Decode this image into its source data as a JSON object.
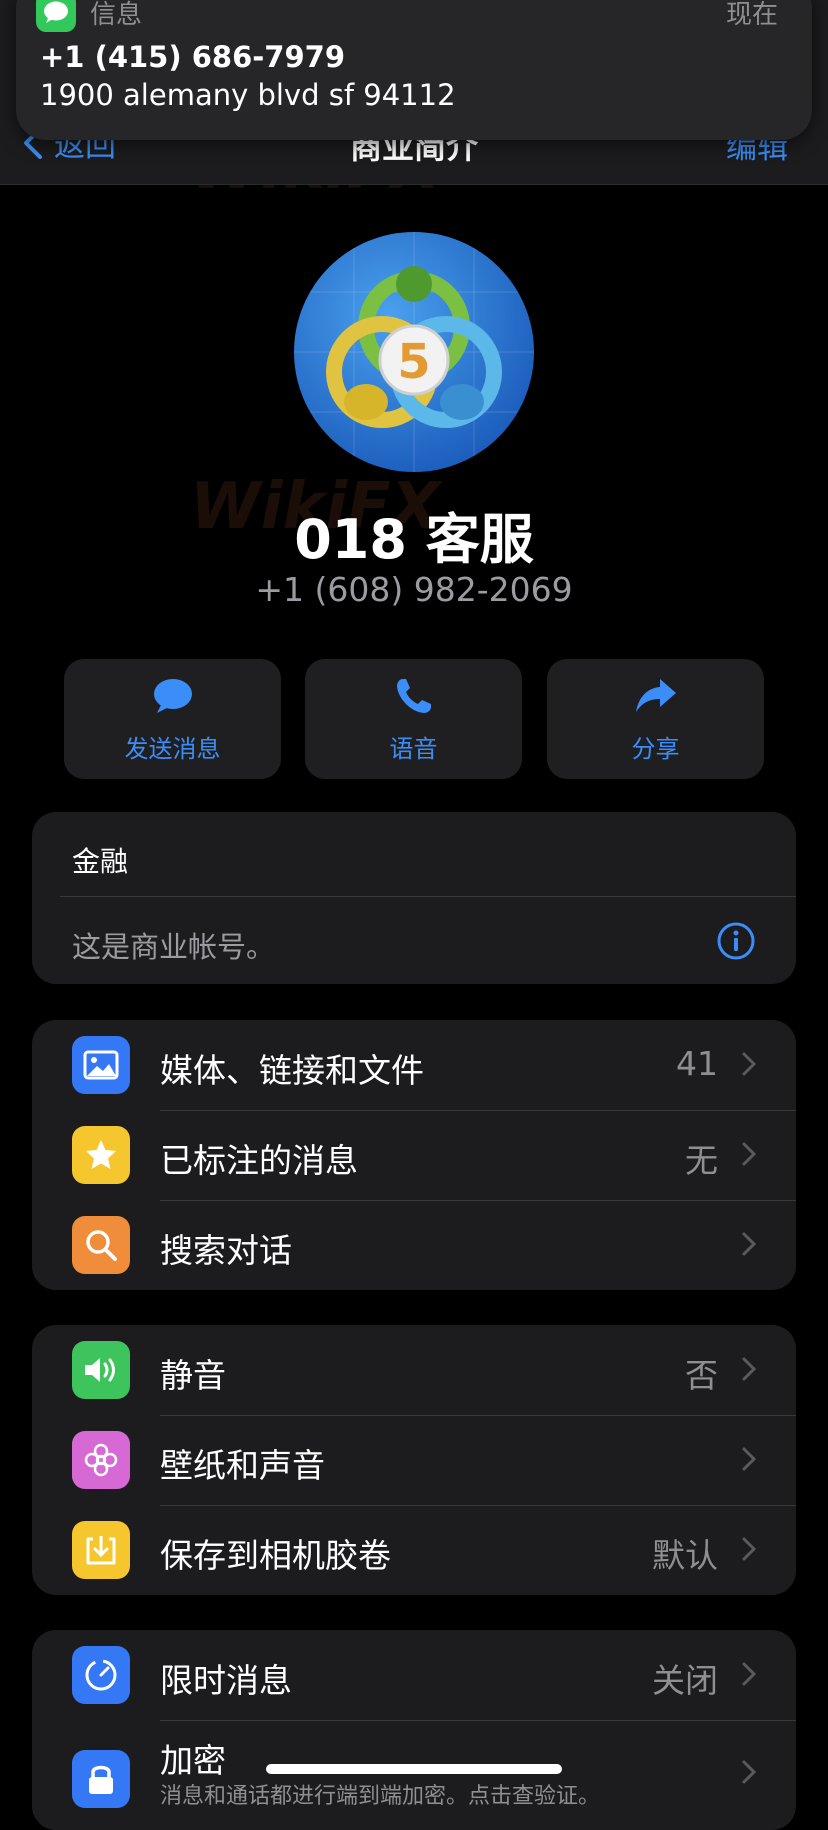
{
  "notification": {
    "app_name": "信息",
    "time": "现在",
    "title": "+1 (415) 686-7979",
    "body": "1900 alemany blvd sf 94112"
  },
  "nav": {
    "back_label": "返回",
    "title": "商业简介",
    "edit_label": "编辑"
  },
  "profile": {
    "name": "018 客服",
    "phone": "+1 (608) 982-2069",
    "avatar_badge": "5"
  },
  "actions": [
    {
      "label": "发送消息",
      "icon": "message-bubble-icon"
    },
    {
      "label": "语音",
      "icon": "phone-icon"
    },
    {
      "label": "分享",
      "icon": "share-arrow-icon"
    }
  ],
  "business_info": {
    "category": "金融",
    "note": "这是商业帐号。"
  },
  "group1": [
    {
      "label": "媒体、链接和文件",
      "value": "41",
      "icon": "photo-icon",
      "color": "#3478f6"
    },
    {
      "label": "已标注的消息",
      "value": "无",
      "icon": "star-icon",
      "color": "#f5c62e"
    },
    {
      "label": "搜索对话",
      "value": "",
      "icon": "search-icon",
      "color": "#f08d3a"
    }
  ],
  "group2": [
    {
      "label": "静音",
      "value": "否",
      "icon": "speaker-icon",
      "color": "#3ec45c"
    },
    {
      "label": "壁纸和声音",
      "value": "",
      "icon": "flower-icon",
      "color": "#d669d4"
    },
    {
      "label": "保存到相机胶卷",
      "value": "默认",
      "icon": "download-icon",
      "color": "#f5c62e"
    }
  ],
  "group3": [
    {
      "label": "限时消息",
      "value": "关闭",
      "icon": "timer-icon",
      "color": "#3478f6"
    },
    {
      "label": "加密",
      "sub": "消息和通话都进行端到端加密。点击查验证。",
      "icon": "lock-icon",
      "color": "#3478f6"
    }
  ],
  "watermark": "WikiFX"
}
